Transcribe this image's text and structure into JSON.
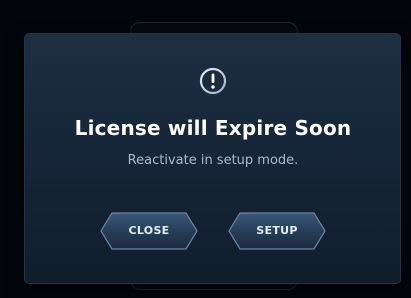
{
  "dialog": {
    "icon": "exclamation-circle-icon",
    "title": "License will Expire Soon",
    "subtitle": "Reactivate in setup mode.",
    "buttons": {
      "close_label": "CLOSE",
      "setup_label": "SETUP"
    }
  },
  "colors": {
    "background": "#02050a",
    "dialog": "#17273a",
    "title_text": "#ffffff",
    "subtitle_text": "#aeb9c6",
    "button_fill": "#2c4460",
    "button_border": "#5d7c9c",
    "button_text": "#e4ecf4"
  }
}
